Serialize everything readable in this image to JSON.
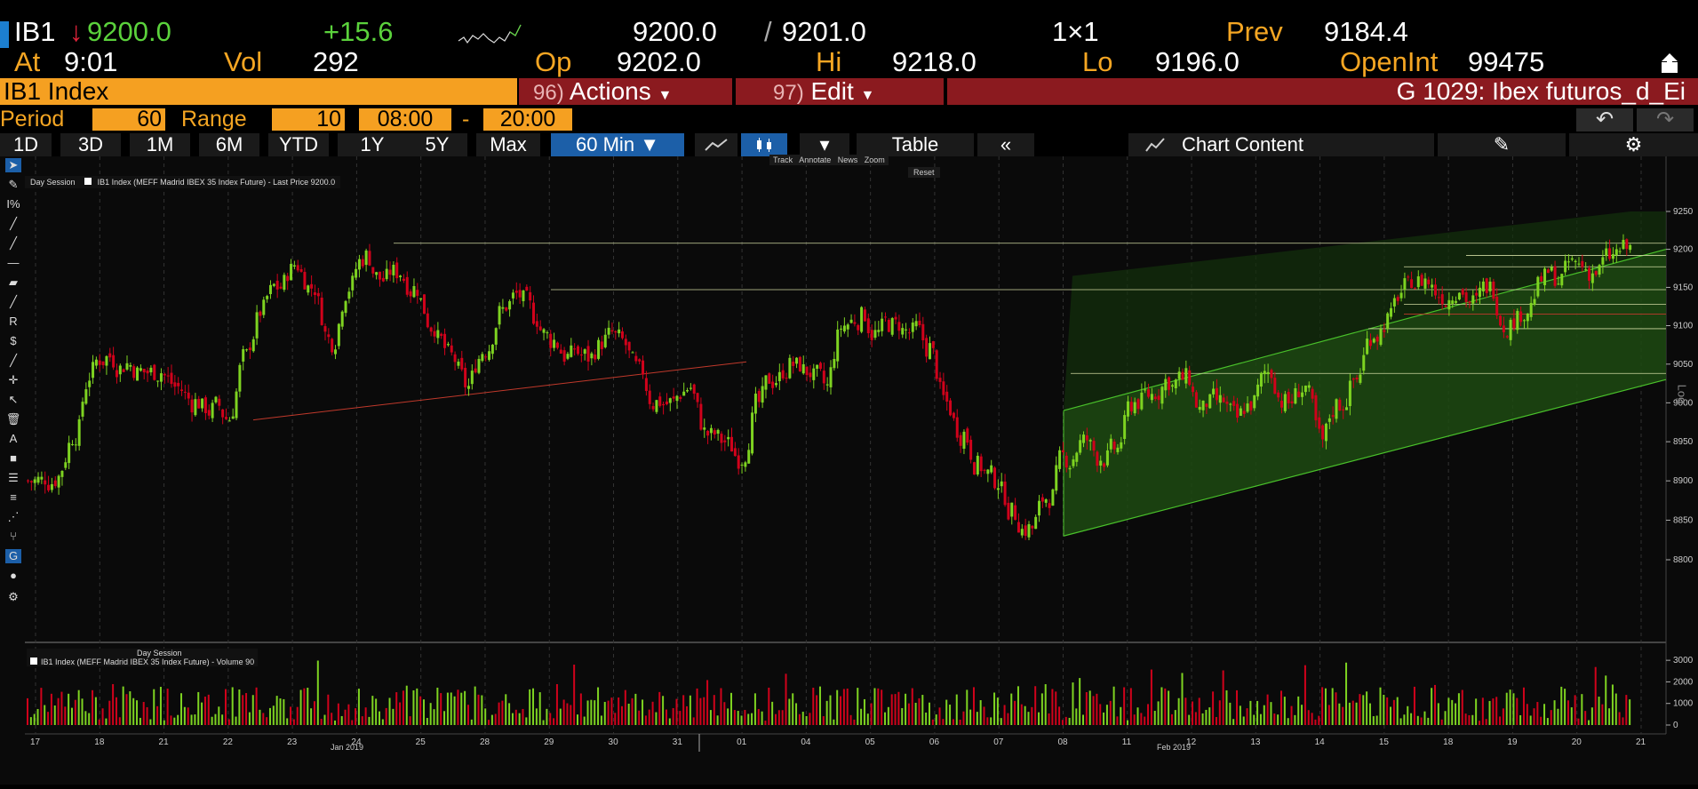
{
  "ticker": {
    "symbol": "IB1",
    "arrow": "↓",
    "last": "9200.0",
    "change": "+15.6",
    "bid_ask": "9200.0",
    "sep": "/",
    "ask": "9201.0",
    "size": "1×1",
    "prev_label": "Prev",
    "prev_value": "9184.4"
  },
  "quote": {
    "at_label": "At",
    "at_time": "9:01",
    "vol_label": "Vol",
    "vol_value": "292",
    "op_label": "Op",
    "op_value": "9202.0",
    "hi_label": "Hi",
    "hi_value": "9218.0",
    "lo_label": "Lo",
    "lo_value": "9196.0",
    "oi_label": "OpenInt",
    "oi_value": "99475"
  },
  "menu": {
    "security": "IB1 Index",
    "actions_num": "96)",
    "actions_label": "Actions",
    "edit_num": "97)",
    "edit_label": "Edit",
    "title": "G 1029: Ibex futuros_d_Ei"
  },
  "period": {
    "period_label": "Period",
    "period_value": "60",
    "range_label": "Range",
    "range_value": "10",
    "start": "08:00",
    "dash": "-",
    "end": "20:00"
  },
  "tabs": {
    "items": [
      "1D",
      "3D",
      "1M",
      "6M",
      "YTD",
      "1Y",
      "5Y",
      "Max"
    ],
    "interval": "60 Min",
    "table": "Table",
    "collapse": "«",
    "chart_content": "Chart Content"
  },
  "chart": {
    "legend_session": "Day Session",
    "legend_series": "IB1 Index (MEFF Madrid IBEX 35 Index Future) - Last Price 9200.0",
    "toolbar_track": "Track",
    "toolbar_annotate": "Annotate",
    "toolbar_news": "News",
    "toolbar_zoom": "Zoom",
    "toolbar_reset": "Reset",
    "log_label": "Log",
    "y_ticks": [
      "9250",
      "9200",
      "9150",
      "9100",
      "9050",
      "9000",
      "8950",
      "8900",
      "8850",
      "8800"
    ],
    "vol_session": "Day Session",
    "vol_series": "IB1 Index (MEFF Madrid IBEX 35 Index Future) - Volume 90",
    "vol_ticks": [
      "3000",
      "2000",
      "1000",
      "0"
    ],
    "x_ticks": [
      "17",
      "18",
      "21",
      "22",
      "23",
      "24",
      "25",
      "28",
      "29",
      "30",
      "31",
      "01",
      "04",
      "05",
      "06",
      "07",
      "08",
      "11",
      "12",
      "13",
      "14",
      "15",
      "18",
      "19",
      "20",
      "21"
    ],
    "month_jan": "Jan 2019",
    "month_feb": "Feb 2019",
    "colors": {
      "up": "#7ed321",
      "down": "#d0021b",
      "channel": "#2e7d1a"
    }
  },
  "chart_data": {
    "type": "candlestick",
    "interval": "60 Min",
    "ylim": [
      8800,
      9250
    ],
    "y_scale": "log",
    "close_path": [
      8900,
      8905,
      8960,
      9040,
      9060,
      9050,
      9040,
      9040,
      9020,
      9000,
      8990,
      8980,
      9060,
      9120,
      9150,
      9180,
      9150,
      9080,
      9150,
      9190,
      9160,
      9170,
      9150,
      9100,
      9060,
      9020,
      9070,
      9120,
      9140,
      9110,
      9080,
      9060,
      9060,
      9080,
      9080,
      9040,
      9000,
      9000,
      9020,
      8960,
      8950,
      8930,
      9000,
      9030,
      9050,
      9040,
      9020,
      9100,
      9110,
      9090,
      9100,
      9090,
      9070,
      9000,
      8960,
      8920,
      8900,
      8860,
      8840,
      8880,
      8930,
      8950,
      8930,
      8940,
      9000,
      9010,
      9030,
      9030,
      8990,
      9000,
      8980,
      9000,
      9040,
      9000,
      9020,
      8950,
      9000,
      9030,
      9090,
      9110,
      9150,
      9160,
      9140,
      9150,
      9130,
      9150,
      9100,
      9120,
      9160,
      9160,
      9180,
      9170,
      9190,
      9200
    ],
    "volume_ylim": [
      0,
      3500
    ]
  }
}
